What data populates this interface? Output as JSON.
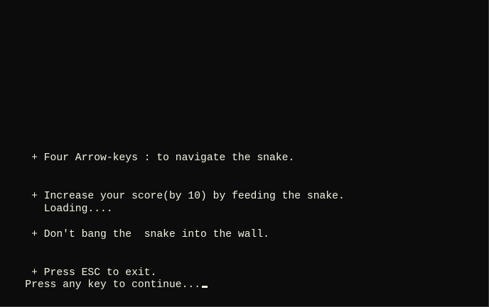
{
  "instructions": [
    "     + Four Arrow-keys : to navigate the snake.",
    "     + Increase your score(by 10) by feeding the snake.",
    "     + Don't bang the  snake into the wall.",
    "     + Press ESC to exit."
  ],
  "loading_text": "       Loading....",
  "prompt_text": "Press any key to continue...",
  "colors": {
    "background": "#0c0c0c",
    "text": "#f2f2e2"
  }
}
